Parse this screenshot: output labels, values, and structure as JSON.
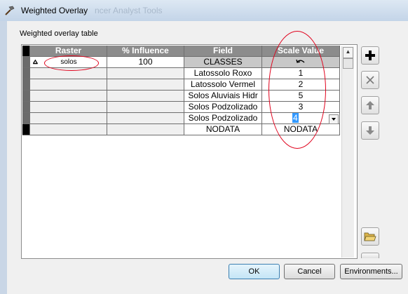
{
  "window": {
    "title": "Weighted Overlay",
    "background_title": "ncer Analyst Tools"
  },
  "section_label": "Weighted overlay table",
  "table": {
    "columns": [
      "Raster",
      "% Influence",
      "Field",
      "Scale Value"
    ],
    "raster_row": {
      "raster": "solos",
      "influence": "100",
      "field": "CLASSES"
    },
    "rows": [
      {
        "field": "Latossolo Roxo",
        "scale": "1"
      },
      {
        "field": "Latossolo Vermel",
        "scale": "2"
      },
      {
        "field": "Solos Aluviais Hidr",
        "scale": "5"
      },
      {
        "field": "Solos Podzolizado",
        "scale": "3"
      },
      {
        "field": "Solos Podzolizado",
        "scale": "4"
      },
      {
        "field": "NODATA",
        "scale": "NODATA"
      }
    ]
  },
  "buttons": {
    "ok": "OK",
    "cancel": "Cancel",
    "environments": "Environments..."
  },
  "side_icons": [
    "add-icon",
    "remove-icon",
    "move-up-icon",
    "move-down-icon",
    "open-folder-icon"
  ],
  "colors": {
    "annotation": "#e0001b",
    "selected_text_bg": "#3399ff"
  }
}
